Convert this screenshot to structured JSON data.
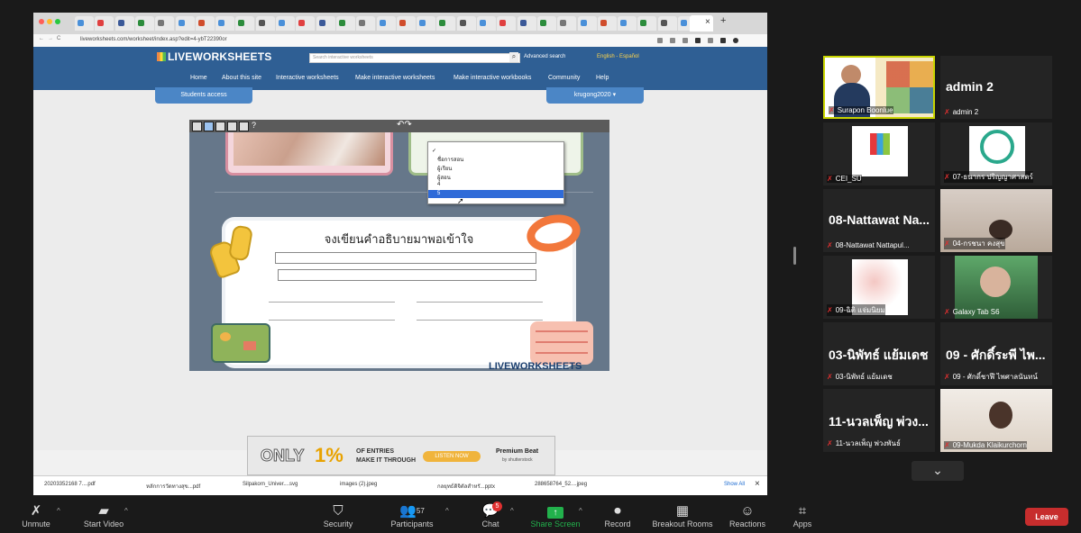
{
  "browser": {
    "url": "liveworksheets.com/worksheet/index.asp?edit=4-ybT22390or",
    "tab_close": "×",
    "tab_new": "+"
  },
  "site": {
    "logo": "LIVEWORKSHEETS",
    "search_placeholder": "Search interactive worksheets",
    "advanced_search": "Advanced search",
    "language": "English - Español",
    "nav": [
      "Home",
      "About this site",
      "Interactive worksheets",
      "Make interactive worksheets",
      "Make interactive workbooks",
      "Community",
      "Help"
    ],
    "students_access": "Students access",
    "user_menu": "krugong2020 ▾"
  },
  "worksheet": {
    "toolbar_help": "?",
    "dropdown_options": [
      "ชื่อการสอน",
      "ผู้เรียน",
      "ผู้สอน",
      "4",
      "5"
    ],
    "heading": "จงเขียนคำอธิบายมาพอเข้าใจ",
    "watermark": "LIVEWORKSHEETS"
  },
  "ad": {
    "only": "ONLY",
    "percent": "1%",
    "line1": "OF ENTRIES",
    "line2": "MAKE IT THROUGH",
    "cta": "LISTEN NOW",
    "brand": "Premium Beat",
    "brand_sub": "by shutterstock"
  },
  "downloads": {
    "items": [
      "20203352168 7....pdf",
      "หลักการวัดทางสุข...pdf",
      "Silpakorn_Univer....svg",
      "images (2).jpeg",
      "กลยุทธ์ดิจิตัลสำหรั...pptx",
      "288658764_52....jpeg"
    ],
    "show_all": "Show All",
    "close": "×"
  },
  "participants": [
    {
      "name": "Surapon Boonlue",
      "type": "video"
    },
    {
      "name": "admin 2",
      "big": "admin 2",
      "type": "name"
    },
    {
      "name": "CEI_SU",
      "type": "logo"
    },
    {
      "name": "07-ธนากร ปริญญาศาสตร์",
      "type": "logo2"
    },
    {
      "name": "08-Nattawat Nattapul...",
      "big": "08-Nattawat Na...",
      "type": "name"
    },
    {
      "name": "04-กรชนา คงสุข",
      "type": "photo"
    },
    {
      "name": "09-ฉิติ แจ่มนิยม",
      "type": "photo2"
    },
    {
      "name": "Galaxy Tab S6",
      "type": "photo3"
    },
    {
      "name": "03-นิพัทธ์ แย้มเดช",
      "big": "03-นิพัทธ์ แย้มเดช",
      "type": "name"
    },
    {
      "name": "09 - ศักดิ์ชาฬี ไพศาลนันทน์",
      "big": "09 - ศักดิ์ระพี ไพ...",
      "type": "name"
    },
    {
      "name": "11-นวลเพ็ญ พ่วงพันธ์",
      "big": "11-นวลเพ็ญ พ่วง...",
      "type": "name"
    },
    {
      "name": "09-Mukda Klaikurchorn",
      "type": "photo4"
    }
  ],
  "gallery_more": "⌄",
  "toolbar": {
    "unmute": "Unmute",
    "start_video": "Start Video",
    "security": "Security",
    "participants": "Participants",
    "participants_count": "57",
    "chat": "Chat",
    "chat_badge": "5",
    "share_screen": "Share Screen",
    "record": "Record",
    "breakout_rooms": "Breakout Rooms",
    "reactions": "Reactions",
    "apps": "Apps",
    "leave": "Leave"
  },
  "colors": {
    "leave": "#c72d2d",
    "share": "#22b14c",
    "site_header": "#2f5f94",
    "worksheet_bg": "#66778a"
  }
}
